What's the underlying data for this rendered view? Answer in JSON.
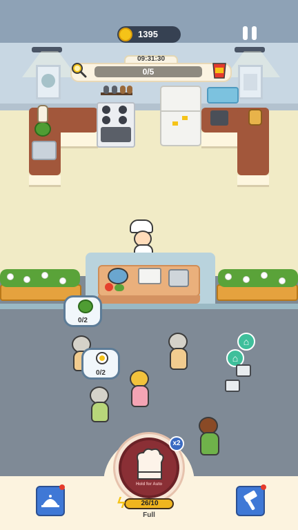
{
  "hud": {
    "coins": "1395",
    "coin_icon": "gold-coin-icon",
    "pause_icon": "pause-icon"
  },
  "order": {
    "timer": "09:31:30",
    "progress": "0/5",
    "progress_value": 0,
    "progress_max": 5,
    "left_icon": "magnifier-icon",
    "right_icon": "chips-bag-icon"
  },
  "customers": [
    {
      "bubble": "0/2",
      "item_icon": "broccoli-icon"
    },
    {
      "bubble": "0/2",
      "item_icon": "egg-icon"
    }
  ],
  "cleanup": {
    "icon": "broom-icon"
  },
  "bottom": {
    "hold_label": "Hold for Auto",
    "multiplier": "x2",
    "energy": "26/10",
    "status": "Full",
    "left_button_icon": "cloche-book-icon",
    "right_button_icon": "hammer-icon"
  },
  "colors": {
    "coin": "#f5c318",
    "hold_button": "#8a2f35",
    "energy_bar": "#f0b51e",
    "cleanup": "#3fbf9b",
    "side_button": "#3f78d6"
  }
}
